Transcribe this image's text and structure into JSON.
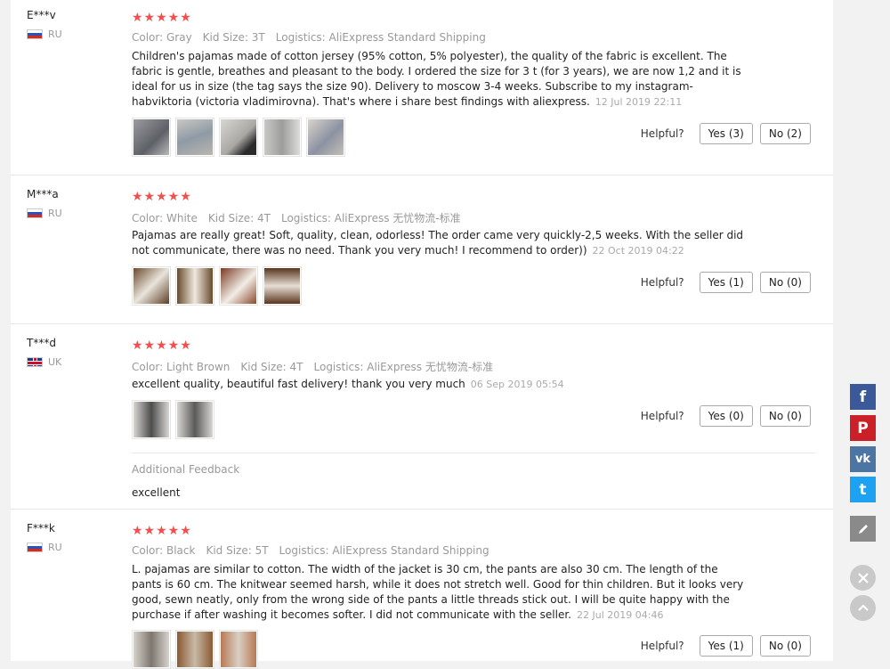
{
  "ui": {
    "helpful_label": "Helpful?",
    "additional_feedback_label": "Additional Feedback",
    "stars": "★★★★★"
  },
  "reviews": [
    {
      "user": "E***v",
      "country": "RU",
      "color": "Color: Gray",
      "kid_size": "Kid Size: 3T",
      "logistics": "Logistics: AliExpress Standard Shipping",
      "text": "Children's pajamas made of cotton jersey (95% cotton, 5% polyester), the quality of the fabric is excellent. The fabric is gentle, breathes and pleasant to the body. I ordered the size for 3 t (for 3 years), we are now 1,2 and it is ideal for us in size (the tag says the size 90). Delivery to moscow 3-4 weeks. Subscribe to my instagram-habviktoria (victoria vladimirovna). That's where i share best findings with aliexpress.",
      "date": "12 Jul 2019 22:11",
      "yes": "Yes (3)",
      "no": "No (2)"
    },
    {
      "user": "M***a",
      "country": "RU",
      "color": "Color: White",
      "kid_size": "Kid Size: 4T",
      "logistics": "Logistics: AliExpress 无忧物流-标准",
      "text": "Pajamas are really great! Soft, quality, clean, odorless! The order came very quickly-2,5 weeks. With the seller did not communicate, there was no need. Thank you very much! I recommend to order))",
      "date": "22 Oct 2019 04:22",
      "yes": "Yes (1)",
      "no": "No (0)"
    },
    {
      "user": "T***d",
      "country": "UK",
      "color": "Color: Light Brown",
      "kid_size": "Kid Size: 4T",
      "logistics": "Logistics: AliExpress 无忧物流-标准",
      "text": "excellent quality, beautiful fast delivery! thank you very much",
      "date": "06 Sep 2019 05:54",
      "yes": "Yes (0)",
      "no": "No (0)",
      "additional_feedback": "excellent"
    },
    {
      "user": "F***k",
      "country": "RU",
      "color": "Color: Black",
      "kid_size": "Kid Size: 5T",
      "logistics": "Logistics: AliExpress Standard Shipping",
      "text": "L. pajamas are similar to cotton. The width of the jacket is 30 cm, the pants are also 30 cm. The length of the pants is 60 cm. The knitwear seemed harsh, while it does not stretch well. Good for thin children. But it looks very good, sewn neatly, only from the wrong side of the pants a little threads stick out. I will be quite happy with the purchase if after washing it becomes softer. I did not communicate with the seller.",
      "date": "22 Jul 2019 04:46",
      "yes": "Yes (1)",
      "no": "No (0)"
    }
  ],
  "side_buttons": {
    "facebook": "f",
    "pinterest": "P",
    "vk": "vk",
    "twitter": "t"
  },
  "colors": {
    "star": "#f14f4f",
    "facebook": "#3b5998",
    "pinterest": "#cb2027",
    "vk": "#4c75a3",
    "twitter": "#1da1f2",
    "edit": "#8a8a8a"
  }
}
